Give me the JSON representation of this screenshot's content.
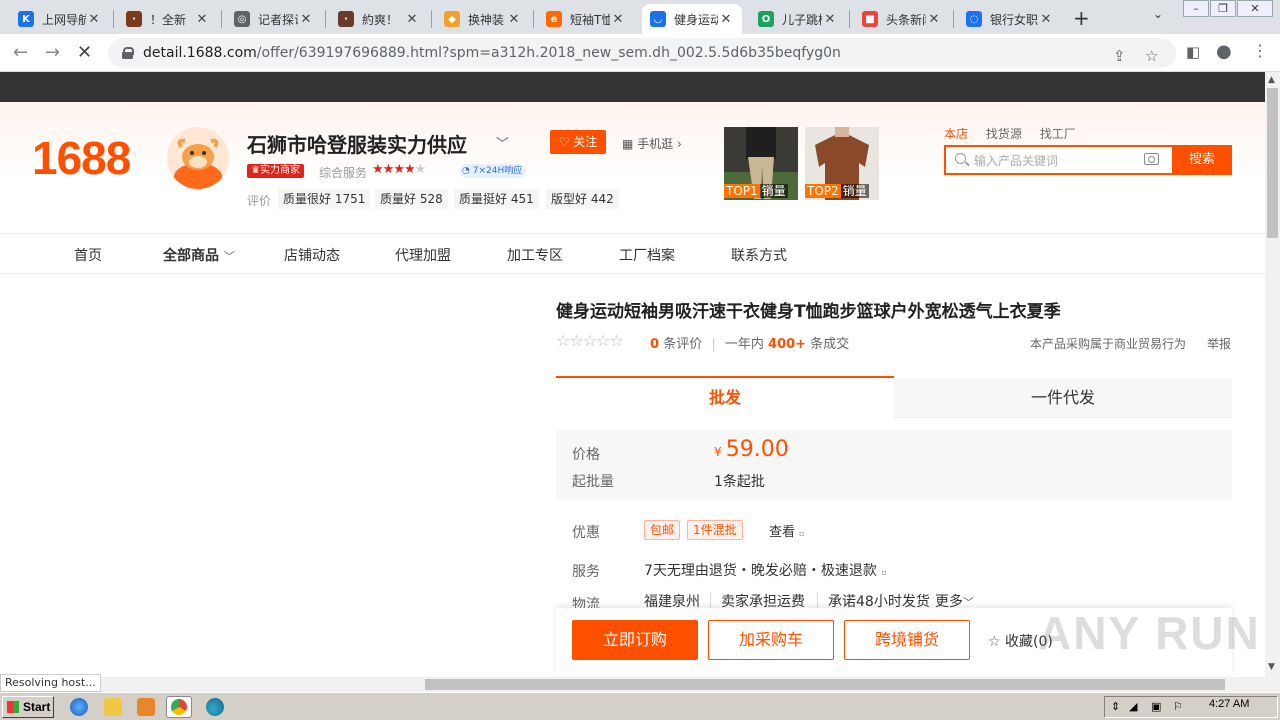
{
  "browser": {
    "tabs": [
      {
        "title": "上网导航",
        "fav_color": "#1a73e8",
        "fav_glyph": "K"
      },
      {
        "title": "！全新",
        "fav_color": "#7a3b1a",
        "fav_glyph": "·"
      },
      {
        "title": "记者探访",
        "fav_color": "#5f6368",
        "fav_glyph": "◎"
      },
      {
        "title": "約爽！",
        "fav_color": "#6b3b2a",
        "fav_glyph": "·"
      },
      {
        "title": "换神装",
        "fav_color": "#f3a12c",
        "fav_glyph": "◆"
      },
      {
        "title": "短袖T恤",
        "fav_color": "#ff6a00",
        "fav_glyph": "e"
      },
      {
        "title": "健身运动",
        "fav_color": "#1a73e8",
        "fav_glyph": "◡",
        "active": true
      },
      {
        "title": "儿子跳楼",
        "fav_color": "#1aa260",
        "fav_glyph": "O"
      },
      {
        "title": "头条新闻",
        "fav_color": "#e8453c",
        "fav_glyph": "■"
      },
      {
        "title": "银行女职",
        "fav_color": "#1a73e8",
        "fav_glyph": "◌"
      }
    ],
    "url_host": "detail.1688.com",
    "url_path": "/offer/639197696889.html?spm=a312h.2018_new_sem.dh_002.5.5d6b35beqfyg0n",
    "status_text": "Resolving host..."
  },
  "shop": {
    "logo": "1688",
    "name": "石狮市哈登服装实力供应",
    "follow_label": "关注",
    "mobile_label": "手机逛",
    "strength_badge": "实力商家",
    "service_label": "综合服务",
    "service_rating": 4,
    "response_badge": "7×24H响应",
    "eval_label": "评价",
    "evals": [
      {
        "text": "质量很好 1751"
      },
      {
        "text": "质量好 528"
      },
      {
        "text": "质量挺好 451"
      },
      {
        "text": "版型好 442"
      }
    ],
    "top_products": [
      {
        "rank": "TOP1",
        "label": "销量"
      },
      {
        "rank": "TOP2",
        "label": "销量"
      }
    ],
    "search_tabs": [
      "本店",
      "找货源",
      "找工厂"
    ],
    "search_placeholder": "输入产品关键词",
    "search_button": "搜索",
    "nav": [
      "首页",
      "全部商品",
      "店铺动态",
      "代理加盟",
      "加工专区",
      "工厂档案",
      "联系方式"
    ]
  },
  "product": {
    "title": "健身运动短袖男吸汗速干衣健身T恤跑步篮球户外宽松透气上衣夏季",
    "review_count": "0",
    "review_label": "条评价",
    "year_label": "一年内",
    "sales_count": "400+",
    "sales_label": "条成交",
    "trade_note": "本产品采购属于商业贸易行为",
    "report": "举报",
    "tab_wholesale": "批发",
    "tab_dropship": "一件代发",
    "price_label": "价格",
    "currency": "¥",
    "price": "59.00",
    "min_order_label": "起批量",
    "min_order": "1条起批",
    "promo_label": "优惠",
    "promo_tags": [
      "包邮",
      "1件混批"
    ],
    "promo_more": "查看",
    "service_label": "服务",
    "service_text": "7天无理由退货・晚发必赔・极速退款",
    "logistics_label": "物流",
    "logistics": [
      "福建泉州",
      "卖家承担运费",
      "承诺48小时发货",
      "更多"
    ],
    "buy_now": "立即订购",
    "add_cart": "加采购车",
    "cross_border": "跨境铺货",
    "favorite": "收藏(0)"
  },
  "taskbar": {
    "start": "Start",
    "clock": "4:27 AM"
  },
  "watermark": "ANY RUN",
  "colors": {
    "accent": "#ff5000",
    "badge_red": "#e1251b"
  }
}
